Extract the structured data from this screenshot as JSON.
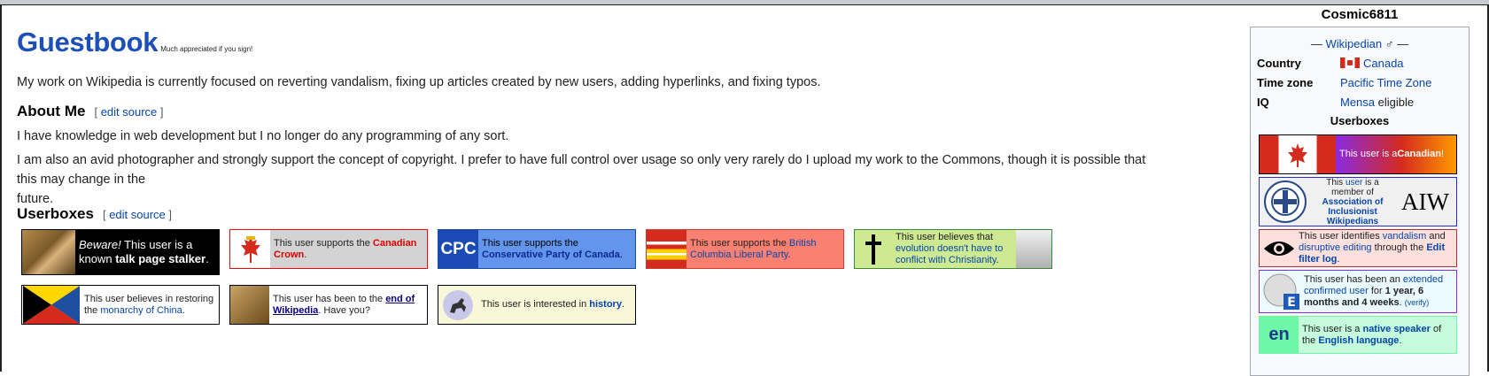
{
  "main": {
    "title": "Guestbook",
    "title_note": "Much appreciated if you sign!",
    "intro": "My work on Wikipedia is currently focused on reverting vandalism, fixing up articles created by new users, adding hyperlinks, and fixing typos.",
    "about": {
      "heading": "About Me",
      "edit_open": "[",
      "edit_label": "edit source",
      "edit_close": "]",
      "para1": "I have knowledge in web development but I no longer do any programming of any sort.",
      "para2_line1": "I am also an avid photographer and strongly support the concept of copyright. I prefer to have full control over usage so only very rarely do I upload my work to the Commons, though it is possible that this may change in the",
      "para2_line2": "future."
    },
    "userboxes_section": {
      "heading": "Userboxes",
      "edit_open": "[",
      "edit_label": "edit source",
      "edit_close": "]"
    },
    "userboxes": {
      "stalker": {
        "beware": "Beware!",
        "t1": " This user is a",
        "t2": "known ",
        "bold": "talk page stalker",
        "end": "."
      },
      "crown": {
        "t1": "This user supports the ",
        "link": "Canadian Crown",
        "end": "."
      },
      "cpc": {
        "icon": "CPC",
        "t1": "This user supports the ",
        "link": "Conservative Party of Canada",
        "end": "."
      },
      "bcliberal": {
        "t1": "This user supports the ",
        "link": "British Columbia Liberal Party",
        "end": "."
      },
      "evolution": {
        "t1": "This user believes that ",
        "link": "evolution doesn't have to conflict with Christianity",
        "end": "."
      },
      "china": {
        "t1": "This user believes in restoring the ",
        "link": "monarchy of China",
        "end": "."
      },
      "endofwiki": {
        "t1": "This user has been to the ",
        "link": "end of Wikipedia",
        "end": ". Have you?"
      },
      "history": {
        "t1": "This user is interested in ",
        "link": "history",
        "end": "."
      }
    }
  },
  "sidebar": {
    "username": "Cosmic6811",
    "sub_dash_l": "—",
    "sub_link": "Wikipedian",
    "sub_symbol": "♂",
    "sub_dash_r": "—",
    "rows": [
      {
        "key": "Country",
        "value": "Canada"
      },
      {
        "key": "Time zone",
        "value": "Pacific Time Zone"
      },
      {
        "key": "IQ",
        "value_link": "Mensa",
        "value_rest": " eligible"
      }
    ],
    "userboxes_title": "Userboxes",
    "userboxes": {
      "canadian": {
        "t1": "This user is a ",
        "bold": "Canadian",
        "end": "!"
      },
      "aiw": {
        "t1": "This ",
        "link1": "user",
        "t2": " is a member of ",
        "link2": "Association of Inclusionist Wikipedians",
        "logo": "AIW"
      },
      "vandalism": {
        "t1": "This user identifies ",
        "link1": "vandalism",
        "t2": " and ",
        "link2": "disruptive editing",
        "t3": " through the ",
        "link3": "Edit filter log",
        "end": "."
      },
      "extended": {
        "t1": "This user has been an ",
        "link": "extended confirmed user",
        "t2": " for ",
        "bold": "1 year, 6 months and 4 weeks",
        "t3": ". ",
        "verify": "(verify)"
      },
      "native": {
        "icon": "en",
        "t1": "This user is a ",
        "link1": "native speaker",
        "t2": " of the ",
        "link2": "English language",
        "end": "."
      }
    }
  },
  "colors": {
    "title_blue": "#1d4fb8",
    "link": "#0645ad",
    "cpc_blue": "#6495ed",
    "bc_salmon": "#fa8072",
    "evolution_green": "#cde992"
  }
}
